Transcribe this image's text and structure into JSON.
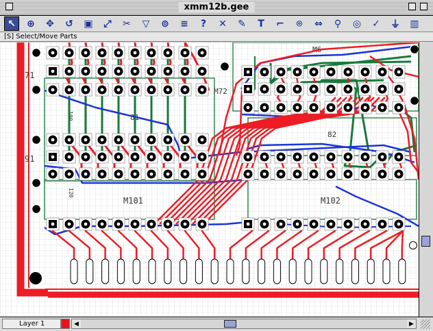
{
  "window": {
    "title": "xmm12b.gee"
  },
  "toolbar": {
    "tools": [
      {
        "name": "select-move-tool",
        "glyph": "↖",
        "active": true
      },
      {
        "name": "zoom-tool",
        "glyph": "⊕"
      },
      {
        "name": "pan-tool",
        "glyph": "✥"
      },
      {
        "name": "rotate-tool",
        "glyph": "↺"
      },
      {
        "name": "part-edit-tool",
        "glyph": "▣"
      },
      {
        "name": "route-tool",
        "glyph": "⤢"
      },
      {
        "name": "cut-track-tool",
        "glyph": "✂"
      },
      {
        "name": "via-tool",
        "glyph": "▽"
      },
      {
        "name": "pad-tool",
        "glyph": "⊚"
      },
      {
        "name": "bus-tool",
        "glyph": "≡"
      },
      {
        "name": "query-tool",
        "glyph": "?"
      },
      {
        "name": "delete-tool",
        "glyph": "✕"
      },
      {
        "name": "pencil-tool",
        "glyph": "✎"
      },
      {
        "name": "text-tool",
        "glyph": "T"
      },
      {
        "name": "corner-tool",
        "glyph": "⌐"
      },
      {
        "name": "component-tool",
        "glyph": "⌾"
      },
      {
        "name": "resize-tool",
        "glyph": "⇔"
      },
      {
        "name": "probe-tool",
        "glyph": "⚲"
      },
      {
        "name": "ring-tool",
        "glyph": "◎"
      },
      {
        "name": "check-tool",
        "glyph": "✓"
      },
      {
        "name": "ground-tool",
        "glyph": "⏚"
      },
      {
        "name": "chip-tool",
        "glyph": "▥"
      }
    ]
  },
  "status": {
    "text": "[S] Select/Move Parts"
  },
  "board": {
    "labels": {
      "row71": "71",
      "row91": "91",
      "m72": "M72",
      "m101": "M101",
      "m102": "M102",
      "m81": "81",
      "m82": "82",
      "m6": "M6",
      "cap100": "100",
      "cap120": "120"
    },
    "colors": {
      "trace_red": "#ee1c24",
      "trace_blue": "#1c34d8",
      "trace_green": "#157a3c",
      "grid": "#c8c8c8"
    }
  },
  "bottom": {
    "layer": "Layer 1"
  }
}
